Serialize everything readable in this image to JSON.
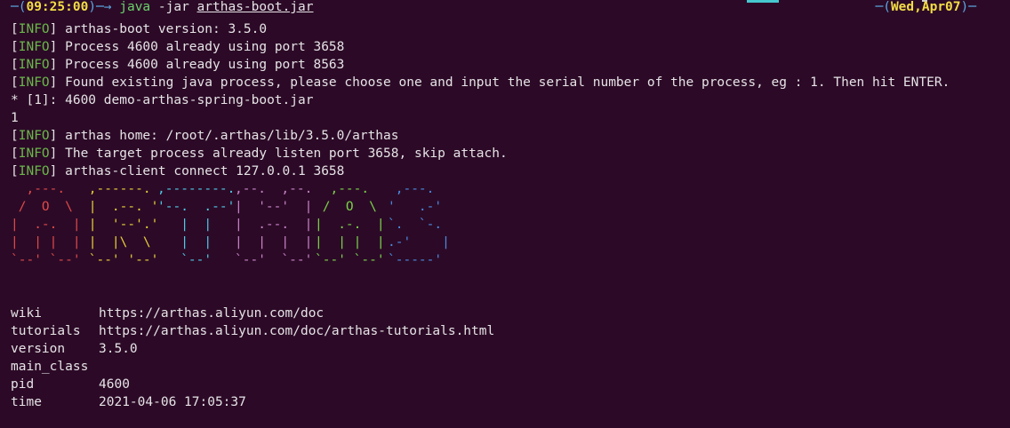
{
  "prompt": {
    "corner_left": "─(",
    "time": "09:25:00",
    "after_time": ")─→ ",
    "command": "java",
    "args": " -jar ",
    "jar": "arthas-boot.jar",
    "date_open": "─(",
    "date": "Wed,Apr07",
    "date_close": ")─"
  },
  "log_lines": [
    {
      "tag": "INFO",
      "text": " arthas-boot version: 3.5.0"
    },
    {
      "tag": "INFO",
      "text": " Process 4600 already using port 3658"
    },
    {
      "tag": "INFO",
      "text": " Process 4600 already using port 8563"
    },
    {
      "tag": "INFO",
      "text": " Found existing java process, please choose one and input the serial number of the process, eg : 1. Then hit ENTER."
    }
  ],
  "process_choice": "* [1]: 4600 demo-arthas-spring-boot.jar",
  "user_input": "1",
  "log_lines_after": [
    {
      "tag": "INFO",
      "text": " arthas home: /root/.arthas/lib/3.5.0/arthas"
    },
    {
      "tag": "INFO",
      "text": " The target process already listen port 3658, skip attach."
    },
    {
      "tag": "INFO",
      "text": " arthas-client connect 127.0.0.1 3658"
    }
  ],
  "logo": {
    "text": "ARTHAS",
    "colors": [
      "#e04a4a",
      "#e8d03a",
      "#4ec9e6",
      "#c882c8",
      "#7ad34a",
      "#4a8be0"
    ],
    "col_a": "  ,---. \n /  O  \\ \n|  .-.  |\n|  | |  |\n`--' `--'",
    "col_r": " ,------. \n |  .--. '\n |  '--'.'\n |  |\\  \\ \n `--' '--'",
    "col_t": ",--------.\n'--.  .--'\n   |  |   \n   |  |   \n   `--'   ",
    "col_h": ",--.  ,--.\n|  '--'  |\n|  .--.  |\n|  |  |  |\n`--'  `--'",
    "col_a2": "  ,---.  \n /  O  \\ \n|  .-.  |\n|  | |  |\n`--' `--'",
    "col_s": " ,---.  \n'   .-' \n`.  `-. \n.-'    |\n`-----' "
  },
  "info": [
    {
      "key": "wiki",
      "value": "https://arthas.aliyun.com/doc"
    },
    {
      "key": "tutorials",
      "value": "https://arthas.aliyun.com/doc/arthas-tutorials.html"
    },
    {
      "key": "version",
      "value": "3.5.0"
    },
    {
      "key": "main_class",
      "value": ""
    },
    {
      "key": "pid",
      "value": "4600"
    },
    {
      "key": "time",
      "value": "2021-04-06 17:05:37"
    }
  ],
  "colors": {
    "background": "#2c0a27",
    "info_tag": "#6ab84a",
    "time": "#f2dc46",
    "frame": "#5aa6e0"
  }
}
